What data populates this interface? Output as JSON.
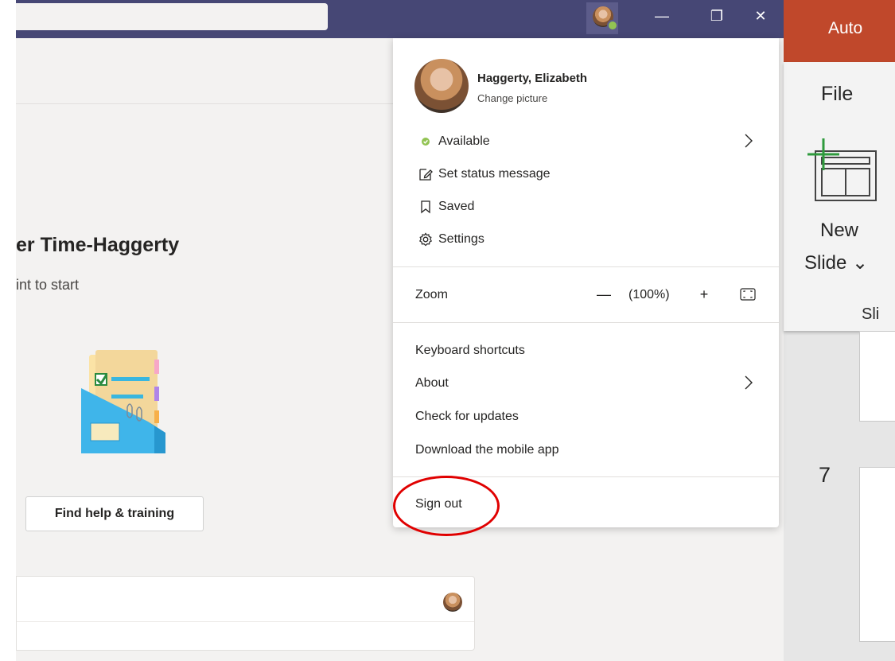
{
  "teams": {
    "team_title": "er Time-Haggerty",
    "team_subtitle": "int to start",
    "help_button": "Find help & training",
    "window_controls": {
      "minimize": "—",
      "restore": "❐",
      "close": "✕"
    }
  },
  "profile_menu": {
    "name": "Haggerty, Elizabeth",
    "change_picture": "Change picture",
    "items": [
      {
        "label": "Available",
        "icon": "status-available-icon",
        "has_chevron": true
      },
      {
        "label": "Set status message",
        "icon": "edit-note-icon"
      },
      {
        "label": "Saved",
        "icon": "bookmark-icon"
      },
      {
        "label": "Settings",
        "icon": "gear-icon"
      }
    ],
    "zoom": {
      "label": "Zoom",
      "minus": "—",
      "level": "(100%)",
      "plus": "+"
    },
    "links": [
      {
        "label": "Keyboard shortcuts"
      },
      {
        "label": "About",
        "has_chevron": true
      },
      {
        "label": "Check for updates"
      },
      {
        "label": "Download the mobile app"
      }
    ],
    "sign_out": "Sign out"
  },
  "powerpoint": {
    "title": "Auto",
    "file_tab": "File",
    "new_label": "New",
    "slide_label": "Slide ⌄",
    "group_label": "Sli",
    "slide_number": "7"
  },
  "colors": {
    "teams_titlebar": "#464775",
    "ppt_titlebar": "#c0482b",
    "available": "#92c353",
    "annotation": "#e00000"
  }
}
